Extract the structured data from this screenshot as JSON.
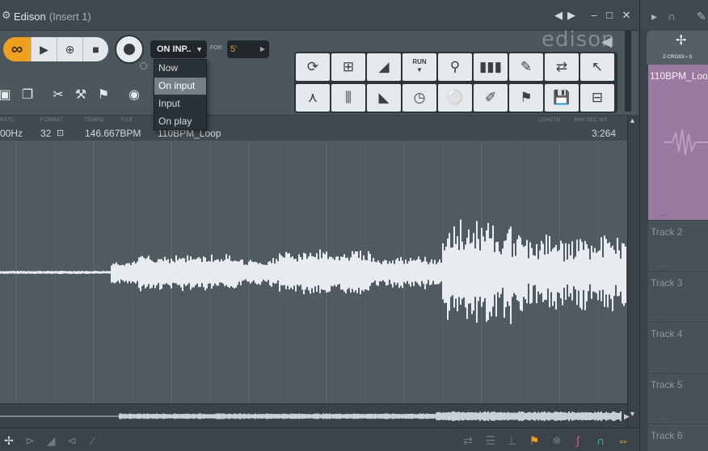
{
  "window": {
    "title": "Edison",
    "subtitle": "(Insert 1)",
    "controls": [
      "◀",
      "▶",
      "–",
      "□",
      "✕"
    ]
  },
  "transport": {
    "loop_icon": "∞",
    "play_icon": "▶",
    "snap_icon": "⊕",
    "stop_icon": "■",
    "record_trigger_value": "ON INP..",
    "for_label": "FOR",
    "for_value": "5'"
  },
  "dropdown": {
    "options": [
      "Now",
      "On input",
      "Input",
      "On play"
    ],
    "selected": "On input"
  },
  "logo": {
    "text": "edison"
  },
  "tools": {
    "row1": [
      "⟳",
      "⊞",
      "◢",
      "RUN",
      "⚲",
      "▮▮▮",
      "✎",
      "⇄",
      "↖"
    ],
    "row2": [
      "⋏",
      "⫼",
      "◣",
      "◷",
      "⚪",
      "✐",
      "⚑",
      "💾",
      "⊟"
    ],
    "run_label": "RUN"
  },
  "info": {
    "samplerate_label": "RATE",
    "samplerate_value": "00Hz",
    "format_label": "FORMAT",
    "format_value": "32",
    "tempo_label": "TEMPO",
    "tempo_value": "146.667BPM",
    "file_label": "FILE",
    "file_value": "110BPM_Loop",
    "length_label": "LENGTH",
    "length_unit_label": "MIN:SEC:MS",
    "length_value": "3:264"
  },
  "playlist": {
    "tab_label": "Z-CROSS • S",
    "clip_label": "110BPM_Loo",
    "clip_dots": "...",
    "tracks": [
      {
        "label": "Track 2",
        "dots": "..."
      },
      {
        "label": "Track 3",
        "dots": "..."
      },
      {
        "label": "Track 4",
        "dots": "..."
      },
      {
        "label": "Track 5",
        "dots": "..."
      },
      {
        "label": "Track 6",
        "dots": "..."
      }
    ]
  },
  "colors": {
    "accent_orange": "#efa01c",
    "waveform": "#e8ecf0",
    "clip_purple": "#9a7b9f",
    "background": "#4f5a62"
  }
}
